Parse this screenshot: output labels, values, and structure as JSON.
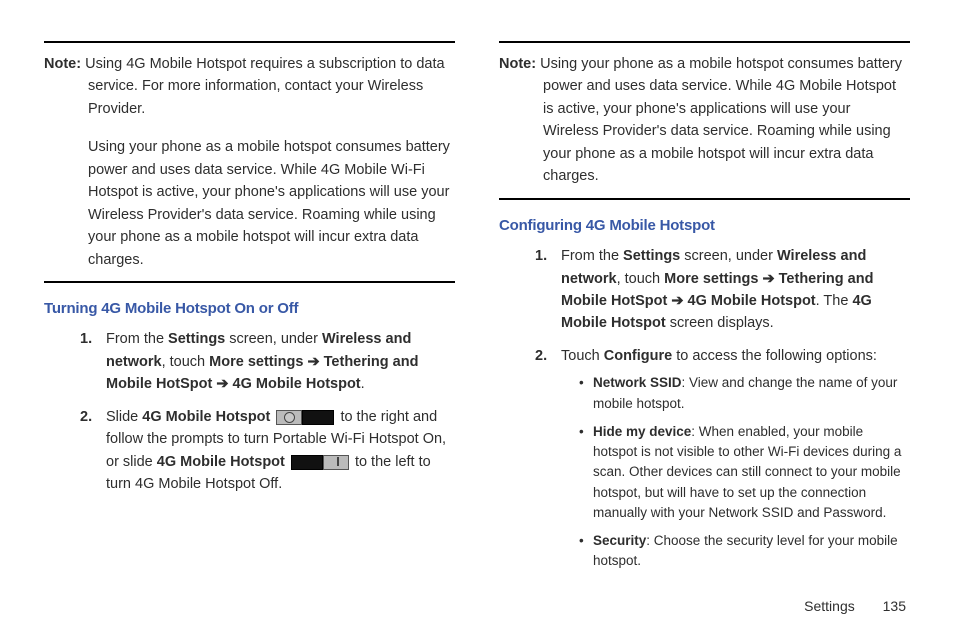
{
  "left": {
    "noteLabel": "Note:",
    "notePara1": "Using 4G Mobile Hotspot requires a subscription to data service. For more information, contact your Wireless Provider.",
    "notePara2": "Using your phone as a mobile hotspot consumes battery power and uses data service. While 4G Mobile Wi-Fi Hotspot is active, your phone's applications will use your Wireless Provider's data service. Roaming while using your phone as a mobile hotspot will incur extra data charges.",
    "heading": "Turning 4G Mobile Hotspot On or Off",
    "step1": {
      "t1": "From the ",
      "b1": "Settings",
      "t2": " screen, under ",
      "b2": "Wireless and network",
      "t3": ", touch ",
      "b3": "More settings",
      "arrow1": " ➔ ",
      "b4": "Tethering and Mobile HotSpot",
      "arrow2": " ➔ ",
      "b5": "4G Mobile Hotspot",
      "t4": "."
    },
    "step2": {
      "t1": "Slide ",
      "b1": "4G Mobile Hotspot",
      "t2": " to the right and follow the prompts to turn Portable Wi-Fi Hotspot On, or slide ",
      "b2": "4G Mobile Hotspot",
      "t3": " to the left to turn 4G Mobile Hotspot Off."
    }
  },
  "right": {
    "noteLabel": "Note:",
    "notePara": "Using your phone as a mobile hotspot consumes battery power and uses data service. While 4G Mobile Hotspot is active, your phone's applications will use your Wireless Provider's data service. Roaming while using your phone as a mobile hotspot will incur extra data charges.",
    "heading": "Configuring 4G Mobile Hotspot",
    "step1": {
      "t1": "From the ",
      "b1": "Settings",
      "t2": " screen, under ",
      "b2": "Wireless and network",
      "t3": ", touch ",
      "b3": "More settings",
      "arrow1": " ➔ ",
      "b4": "Tethering and Mobile HotSpot",
      "arrow2": " ➔ ",
      "b5": "4G Mobile Hotspot",
      "t4": ". The ",
      "b6": "4G Mobile Hotspot",
      "t5": " screen displays."
    },
    "step2": {
      "t1": "Touch ",
      "b1": "Configure",
      "t2": " to access the following options:"
    },
    "bullets": {
      "b1Label": "Network SSID",
      "b1Text": ": View and change the name of your mobile hotspot.",
      "b2Label": "Hide my device",
      "b2Text": ": When enabled, your mobile hotspot is not visible to other Wi-Fi devices during a scan. Other devices can still connect to your mobile hotspot, but  will have to set up the connection manually with your Network SSID and Password.",
      "b3Label": "Security",
      "b3Text": ": Choose the security level for your mobile hotspot."
    }
  },
  "footer": {
    "section": "Settings",
    "page": "135"
  }
}
